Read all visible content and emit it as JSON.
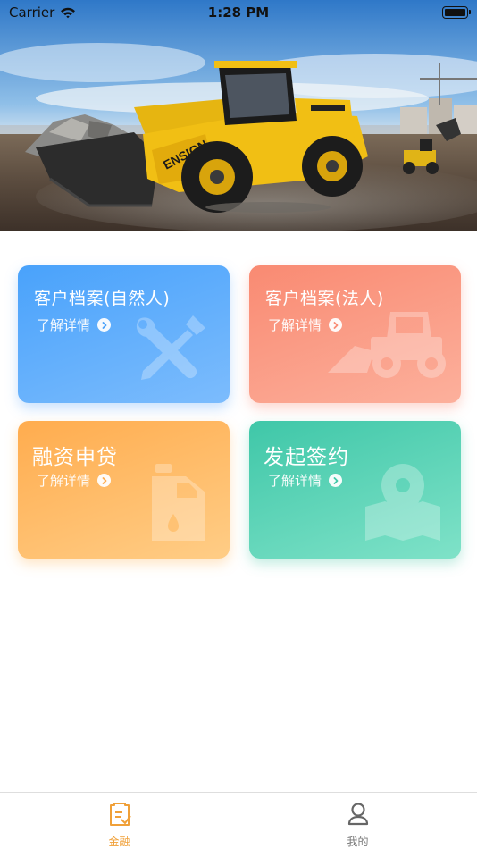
{
  "status_bar": {
    "carrier": "Carrier",
    "time": "1:28 PM"
  },
  "banner": {
    "loader_brand": "ENSIGN"
  },
  "cards": [
    {
      "title": "客户档案(自然人)",
      "detail": "了解详情",
      "icon": "wrench-screwdriver-icon"
    },
    {
      "title": "客户档案(法人)",
      "detail": "了解详情",
      "icon": "wheel-loader-icon"
    },
    {
      "title": "融资申贷",
      "detail": "了解详情",
      "icon": "oil-can-icon"
    },
    {
      "title": "发起签约",
      "detail": "了解详情",
      "icon": "map-pin-icon"
    }
  ],
  "tab_bar": {
    "tabs": [
      {
        "label": "金融",
        "icon": "finance-document-icon",
        "active": true
      },
      {
        "label": "我的",
        "icon": "profile-icon",
        "active": false
      }
    ]
  },
  "colors": {
    "card_blue": "#49a2fb",
    "card_red": "#f98a72",
    "card_orange": "#ffac4e",
    "card_green": "#3fc7a8",
    "tab_active": "#f0a038",
    "tab_inactive": "#777777"
  }
}
